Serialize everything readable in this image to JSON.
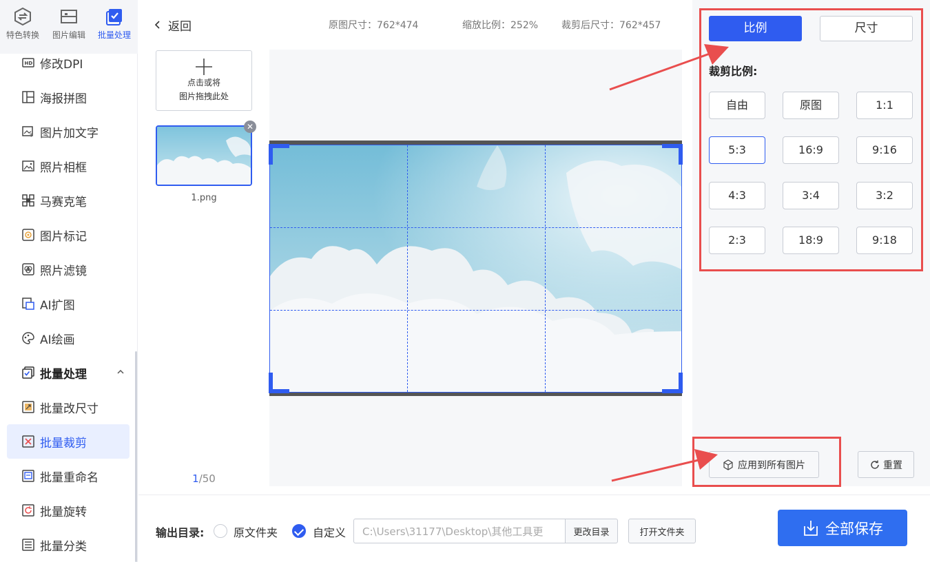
{
  "top_tabs": [
    {
      "label": "特色转换",
      "icon": "convert-icon"
    },
    {
      "label": "图片编辑",
      "icon": "image-edit-icon"
    },
    {
      "label": "批量处理",
      "icon": "batch-icon"
    }
  ],
  "sidebar": {
    "items": [
      {
        "label": "修改DPI",
        "icon": "hd-icon"
      },
      {
        "label": "海报拼图",
        "icon": "poster-collage-icon"
      },
      {
        "label": "图片加文字",
        "icon": "add-text-icon"
      },
      {
        "label": "照片相框",
        "icon": "photo-frame-icon"
      },
      {
        "label": "马赛克笔",
        "icon": "mosaic-icon"
      },
      {
        "label": "图片标记",
        "icon": "mark-icon"
      },
      {
        "label": "照片滤镜",
        "icon": "filter-icon"
      },
      {
        "label": "AI扩图",
        "icon": "ai-expand-icon"
      },
      {
        "label": "AI绘画",
        "icon": "ai-paint-icon"
      }
    ],
    "group": {
      "label": "批量处理",
      "icon": "batch-icon",
      "expanded": true
    },
    "sub_items": [
      {
        "label": "批量改尺寸",
        "icon": "resize-icon"
      },
      {
        "label": "批量裁剪",
        "icon": "crop-icon",
        "active": true
      },
      {
        "label": "批量重命名",
        "icon": "rename-icon"
      },
      {
        "label": "批量旋转",
        "icon": "rotate-icon"
      },
      {
        "label": "批量分类",
        "icon": "classify-icon"
      }
    ]
  },
  "header": {
    "back_label": "返回",
    "original_size": "原图尺寸：762*474",
    "zoom_ratio": "缩放比例：252%",
    "cropped_size": "裁剪后尺寸：762*457"
  },
  "upload": {
    "line1": "点击或将",
    "line2": "图片拖拽此处"
  },
  "thumbnail": {
    "filename": "1.png"
  },
  "pager": {
    "current": "1",
    "total": "/50"
  },
  "right_panel": {
    "mode_ratio": "比例",
    "mode_size": "尺寸",
    "section_label": "裁剪比例:",
    "ratios": [
      "自由",
      "原图",
      "1:1",
      "5:3",
      "16:9",
      "9:16",
      "4:3",
      "3:4",
      "3:2",
      "2:3",
      "18:9",
      "9:18"
    ],
    "selected_ratio": "5:3",
    "apply_all": "应用到所有图片",
    "reset": "重置"
  },
  "bottom": {
    "output_label": "输出目录:",
    "opt_original": "原文件夹",
    "opt_custom": "自定义",
    "selected_option": "自定义",
    "path_value": "C:\\Users\\31177\\Desktop\\其他工具更",
    "change_dir": "更改目录",
    "open_folder": "打开文件夹",
    "save_all": "全部保存"
  },
  "colors": {
    "accent": "#2f5cf0",
    "save_button": "#2f6ef0",
    "annotation_red": "#e94e4e",
    "active_nav_bg": "#e9efff"
  }
}
